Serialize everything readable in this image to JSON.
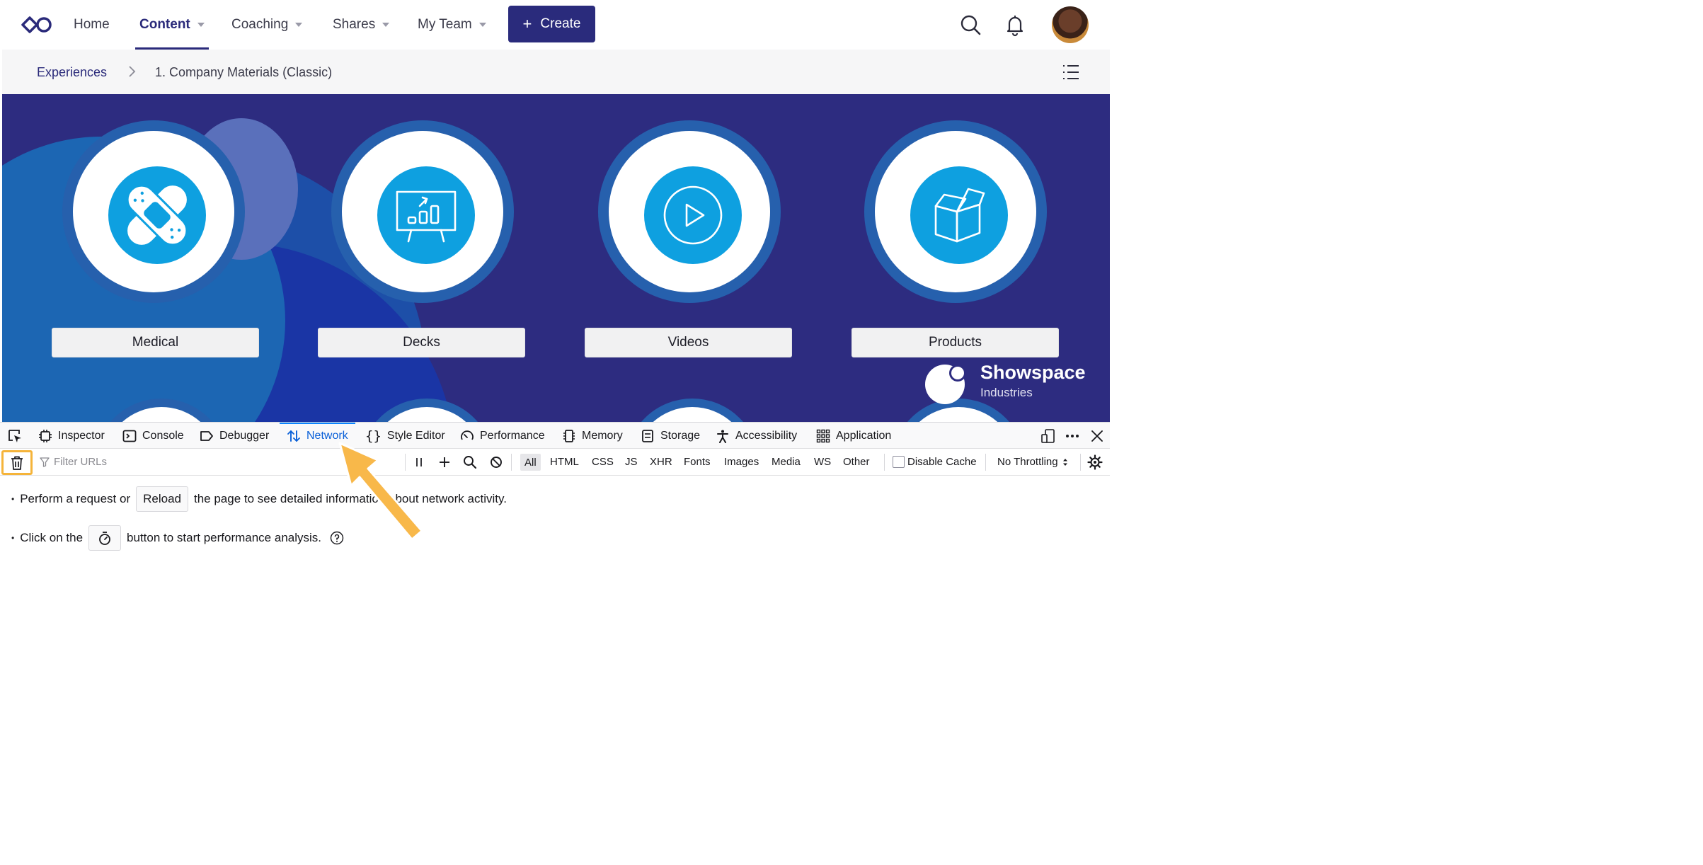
{
  "nav": {
    "items": [
      {
        "label": "Home",
        "dropdown": false
      },
      {
        "label": "Content",
        "dropdown": true,
        "active": true
      },
      {
        "label": "Coaching",
        "dropdown": true
      },
      {
        "label": "Shares",
        "dropdown": true
      },
      {
        "label": "My Team",
        "dropdown": true
      }
    ],
    "create_label": "Create",
    "icons": [
      "logo-icon",
      "search-icon",
      "bell-icon",
      "avatar"
    ]
  },
  "breadcrumb": {
    "root": "Experiences",
    "current": "1. Company Materials (Classic)"
  },
  "hero": {
    "cards": [
      {
        "label": "Medical",
        "icon": "bandage-icon"
      },
      {
        "label": "Decks",
        "icon": "presentation-chart-icon"
      },
      {
        "label": "Videos",
        "icon": "play-icon"
      },
      {
        "label": "Products",
        "icon": "open-box-icon"
      }
    ],
    "brand": {
      "name": "Showspace",
      "sub": "Industries"
    },
    "colors": {
      "background": "#2d2c80",
      "disc": "#0ea0e0",
      "ring": "#2660ad"
    }
  },
  "devtools": {
    "tabs": [
      {
        "label": "Inspector",
        "icon": "inspector-icon"
      },
      {
        "label": "Console",
        "icon": "console-icon"
      },
      {
        "label": "Debugger",
        "icon": "debugger-icon"
      },
      {
        "label": "Network",
        "icon": "network-icon",
        "active": true
      },
      {
        "label": "Style Editor",
        "icon": "style-editor-icon"
      },
      {
        "label": "Performance",
        "icon": "performance-icon"
      },
      {
        "label": "Memory",
        "icon": "memory-icon"
      },
      {
        "label": "Storage",
        "icon": "storage-icon"
      },
      {
        "label": "Accessibility",
        "icon": "accessibility-icon"
      },
      {
        "label": "Application",
        "icon": "application-icon"
      }
    ],
    "filter_placeholder": "Filter URLs",
    "filter_types": [
      "All",
      "HTML",
      "CSS",
      "JS",
      "XHR",
      "Fonts",
      "Images",
      "Media",
      "WS",
      "Other"
    ],
    "disable_cache_label": "Disable Cache",
    "throttling_label": "No Throttling",
    "messages": {
      "line1_pre": "Perform a request or",
      "reload_label": "Reload",
      "line1_post": "the page to see detailed information about network activity.",
      "line2_pre": "Click on the",
      "line2_post": "button to start performance analysis."
    },
    "highlight_color": "#f5b43a"
  }
}
